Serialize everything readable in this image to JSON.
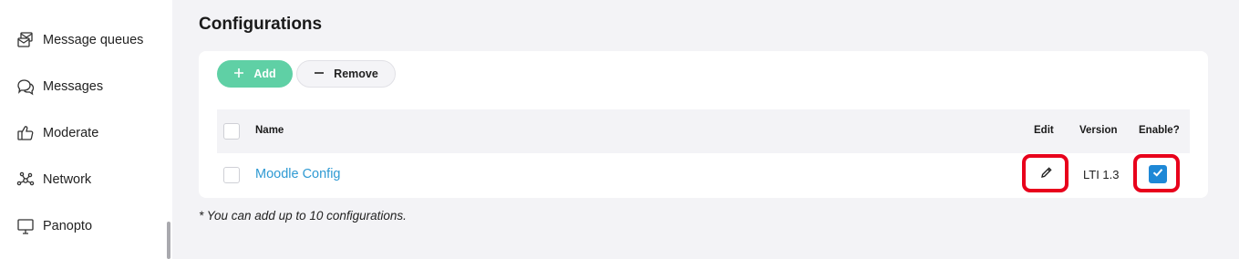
{
  "sidebar": {
    "items": [
      {
        "label": "Message queues",
        "icon": "message-queue-icon"
      },
      {
        "label": "Messages",
        "icon": "chat-bubbles-icon"
      },
      {
        "label": "Moderate",
        "icon": "thumbs-up-icon"
      },
      {
        "label": "Network",
        "icon": "network-icon"
      },
      {
        "label": "Panopto",
        "icon": "monitor-icon"
      }
    ]
  },
  "page": {
    "title": "Configurations",
    "note": "* You can add up to 10 configurations."
  },
  "toolbar": {
    "add_label": "Add",
    "remove_label": "Remove"
  },
  "table": {
    "columns": {
      "name": "Name",
      "edit": "Edit",
      "version": "Version",
      "enable": "Enable?"
    },
    "rows": [
      {
        "name": "Moodle Config",
        "version": "LTI 1.3",
        "enabled": true
      }
    ]
  },
  "colors": {
    "accent_green": "#5fd0a5",
    "link_blue": "#2f9ad3",
    "checkbox_blue": "#1e88d6",
    "highlight_red": "#e8001b"
  }
}
